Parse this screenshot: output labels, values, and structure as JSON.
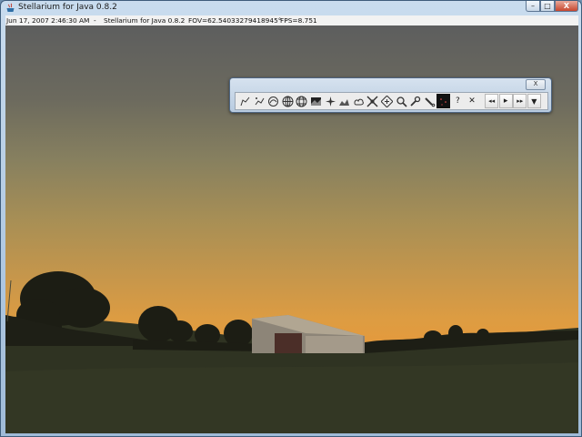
{
  "window": {
    "title": "Stellarium for Java 0.8.2",
    "buttons": {
      "minimize": "–",
      "maximize": "□",
      "close": "X"
    }
  },
  "statusbar": {
    "date": "Jun 17, 2007 2:46:30 AM",
    "separator": "-",
    "app": "Stellarium for Java 0.8.2",
    "fov": "FOV=62.54033279418945°",
    "fps": "FPS=8.751"
  },
  "toolbar": {
    "close_label": "X",
    "buttons": [
      {
        "name": "constellation-lines-icon"
      },
      {
        "name": "constellation-names-icon"
      },
      {
        "name": "constellation-art-icon"
      },
      {
        "name": "azimuth-grid-icon"
      },
      {
        "name": "equatorial-grid-icon"
      },
      {
        "name": "ground-icon"
      },
      {
        "name": "cardinal-points-icon"
      },
      {
        "name": "landscape-icon"
      },
      {
        "name": "atmosphere-icon"
      },
      {
        "name": "nebulae-icon"
      },
      {
        "name": "center-selection-icon"
      },
      {
        "name": "search-icon"
      },
      {
        "name": "config-icon"
      },
      {
        "name": "telescope-icon"
      },
      {
        "name": "night-mode-icon"
      },
      {
        "name": "help-icon",
        "label": "?"
      },
      {
        "name": "quit-icon",
        "label": "✕"
      },
      {
        "name": "rewind-icon",
        "label": "◂◂"
      },
      {
        "name": "real-time-icon",
        "label": "▸"
      },
      {
        "name": "fast-forward-icon",
        "label": "▸▸"
      },
      {
        "name": "hide-toolbar-icon",
        "label": "▼"
      }
    ]
  }
}
